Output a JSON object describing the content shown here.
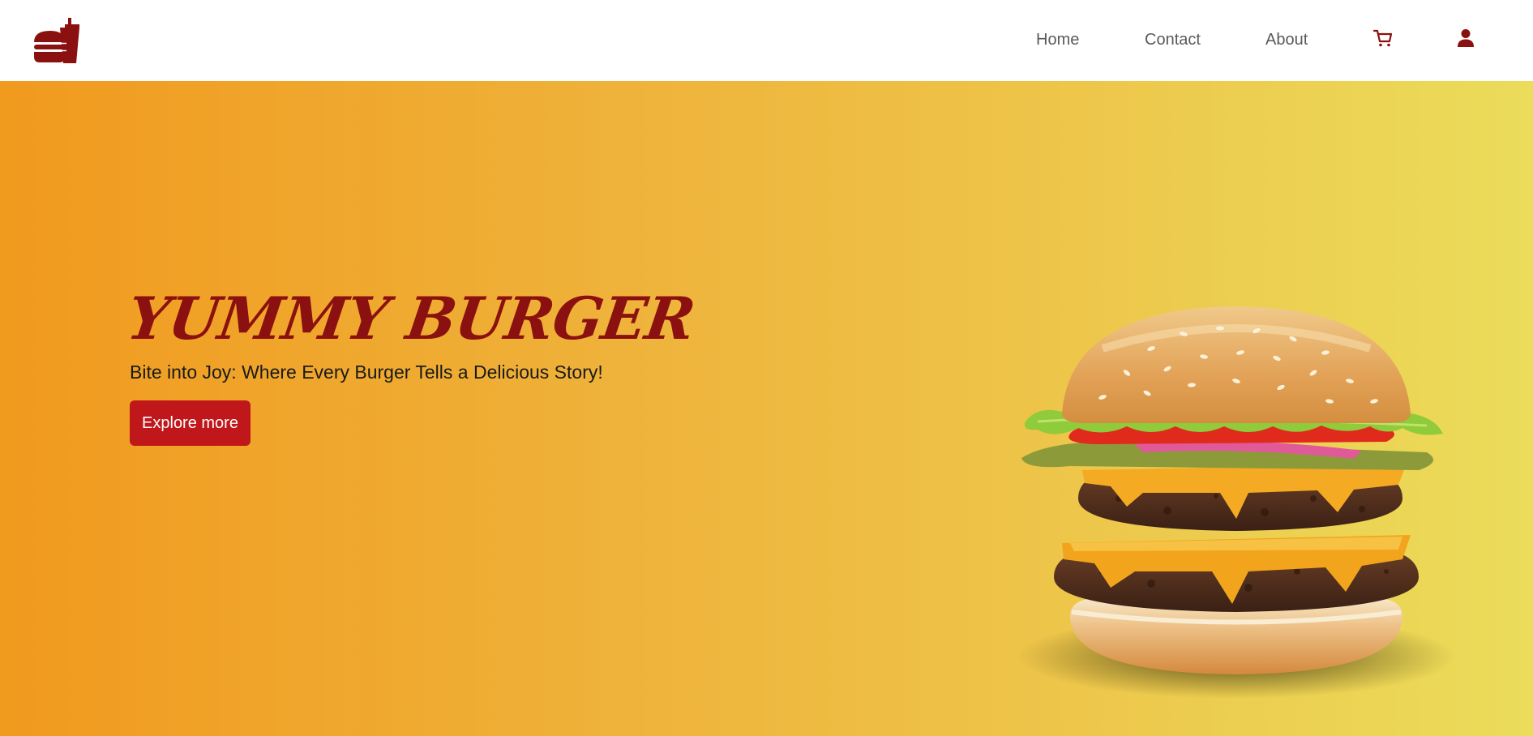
{
  "nav": {
    "logo_icon": "burger-drink-logo-icon",
    "links": [
      {
        "label": "Home"
      },
      {
        "label": "Contact"
      },
      {
        "label": "About"
      }
    ],
    "cart_icon": "cart-icon",
    "user_icon": "user-icon"
  },
  "hero": {
    "title": "YUMMY BURGER",
    "subtitle": "Bite into Joy: Where Every Burger Tells a Delicious Story!",
    "cta_label": "Explore more",
    "image_icon": "double-cheeseburger-image"
  },
  "colors": {
    "brand_dark_red": "#8b1010",
    "button_red": "#c0171a",
    "gradient_start": "#f09a1e",
    "gradient_end": "#ebdc5a",
    "nav_text": "#5a5a5a"
  }
}
